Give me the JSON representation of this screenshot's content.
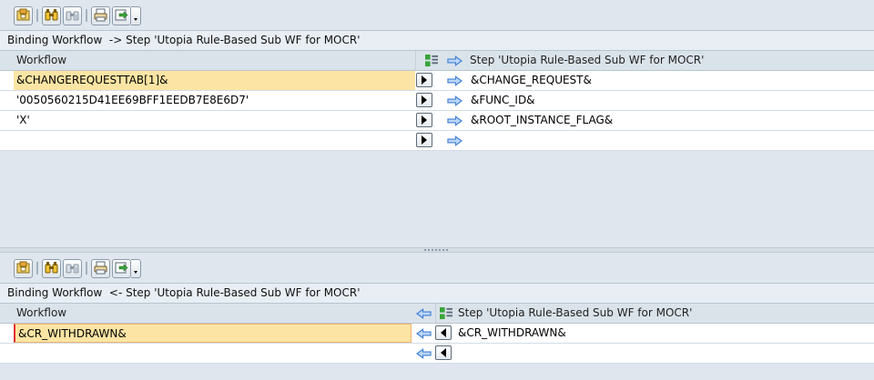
{
  "toolbar": {
    "buttons": [
      {
        "icon": "details-icon"
      },
      {
        "icon": "find-icon"
      },
      {
        "icon": "find-next-icon"
      },
      {
        "icon": "print-icon"
      },
      {
        "icon": "export-icon"
      }
    ]
  },
  "export_binding": {
    "title": "Binding Workflow  -> Step 'Utopia Rule-Based Sub WF for MOCR'",
    "left_header": "Workflow",
    "right_header": "Step 'Utopia Rule-Based Sub WF for MOCR'",
    "rows": [
      {
        "source": "&CHANGEREQUESTTAB[1]&",
        "target": "&CHANGE_REQUEST&"
      },
      {
        "source": "'0050560215D41EE69BFF1EEDB7E8E6D7'",
        "target": "&FUNC_ID&"
      },
      {
        "source": "'X'",
        "target": "&ROOT_INSTANCE_FLAG&"
      },
      {
        "source": "",
        "target": ""
      }
    ]
  },
  "import_binding": {
    "title": "Binding Workflow  <- Step 'Utopia Rule-Based Sub WF for MOCR'",
    "left_header": "Workflow",
    "right_header": "Step 'Utopia Rule-Based Sub WF for MOCR'",
    "rows": [
      {
        "target": "&CR_WITHDRAWN&",
        "source": "&CR_WITHDRAWN&"
      },
      {
        "target": "",
        "source": ""
      }
    ]
  },
  "colors": {
    "highlight": "#fce5a4",
    "arrow_blue": "#3f7fd6",
    "background": "#dfe6ed"
  }
}
